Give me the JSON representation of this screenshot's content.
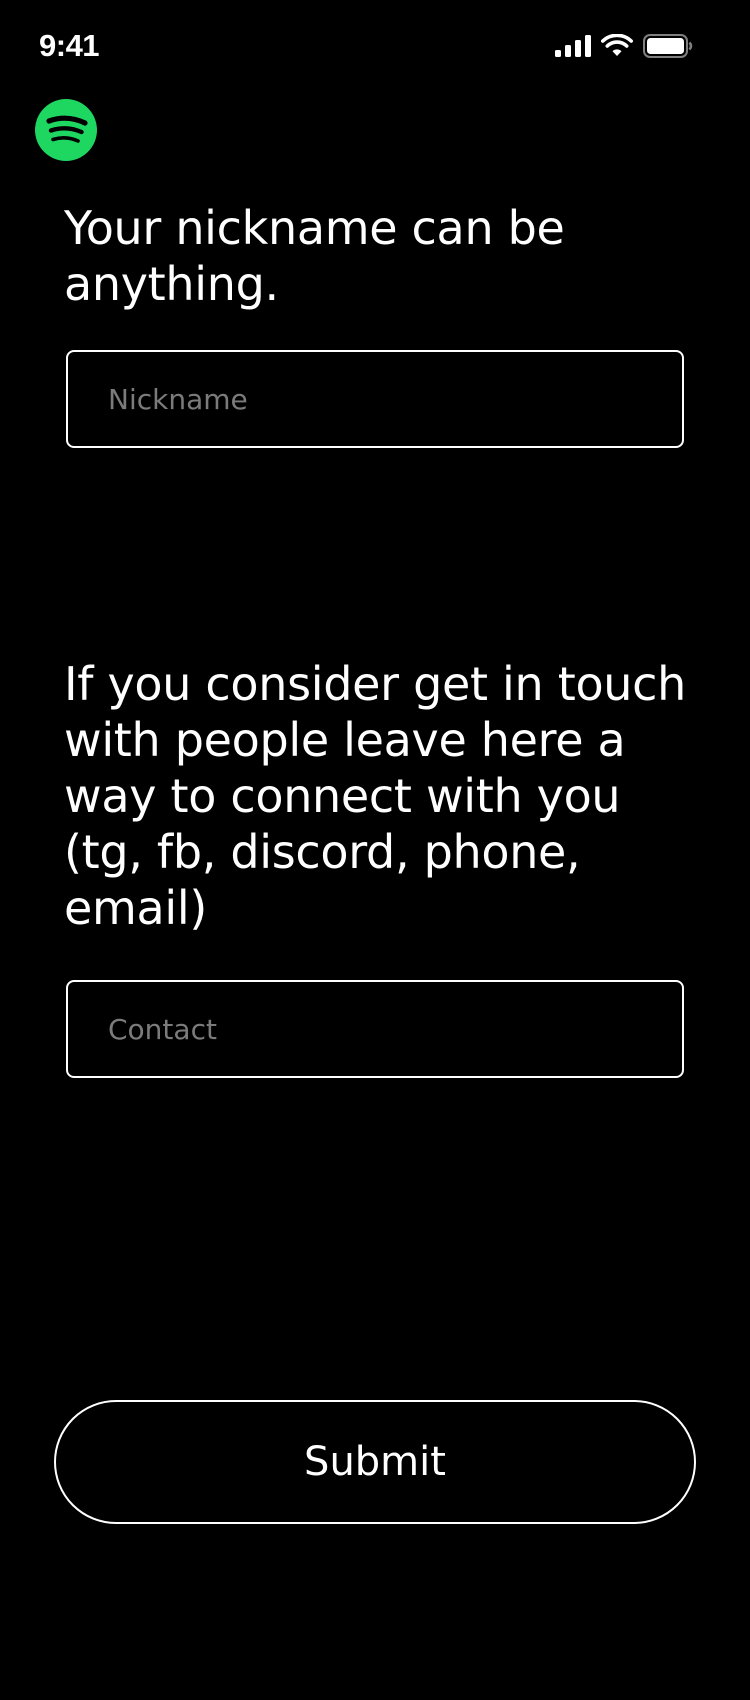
{
  "status_bar": {
    "time": "9:41",
    "icons": [
      "cellular-signal-icon",
      "wifi-icon",
      "battery-icon"
    ]
  },
  "brand": {
    "logo_icon": "spotify-logo-icon",
    "accent_color": "#1ed760"
  },
  "nickname_section": {
    "heading": "Your nickname can be anything.",
    "input_placeholder": "Nickname",
    "input_value": ""
  },
  "contact_section": {
    "heading": "If you consider get in touch with people leave here a way to connect with you (tg, fb, discord, phone, email)",
    "input_placeholder": "Contact",
    "input_value": ""
  },
  "actions": {
    "submit_label": "Submit"
  },
  "colors": {
    "background": "#000000",
    "text": "#ffffff",
    "placeholder": "#7b7b7b",
    "border": "#ffffff"
  }
}
